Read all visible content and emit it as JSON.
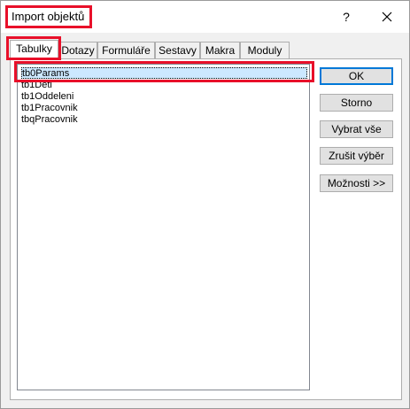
{
  "window": {
    "title": "Import objektů",
    "help_label": "?",
    "close_icon": "close-icon"
  },
  "tabs": [
    {
      "label": "Tabulky",
      "active": true
    },
    {
      "label": "Dotazy",
      "active": false
    },
    {
      "label": "Formuláře",
      "active": false
    },
    {
      "label": "Sestavy",
      "active": false
    },
    {
      "label": "Makra",
      "active": false
    },
    {
      "label": "Moduly",
      "active": false
    }
  ],
  "list": {
    "items": [
      {
        "label": "tb0Params",
        "selected": true
      },
      {
        "label": "tb1Deti",
        "selected": false
      },
      {
        "label": "tb1Oddeleni",
        "selected": false
      },
      {
        "label": "tb1Pracovnik",
        "selected": false
      },
      {
        "label": "tbqPracovnik",
        "selected": false
      }
    ]
  },
  "buttons": {
    "ok": "OK",
    "cancel": "Storno",
    "select_all": "Vybrat vše",
    "deselect_all": "Zrušit výběr",
    "options": "Možnosti >>"
  },
  "colors": {
    "highlight_annotation": "#e8102a",
    "selection_background": "#cce8ff",
    "default_button_border": "#0078d7"
  }
}
